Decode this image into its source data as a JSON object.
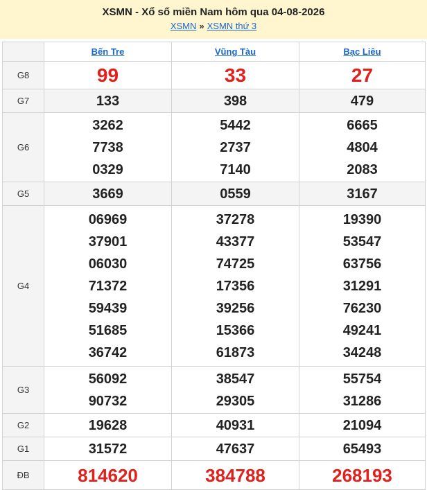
{
  "header": {
    "title": "XSMN - Xổ số miền Nam hôm qua 04-08-2026",
    "crumb_link1": "XSMN",
    "crumb_sep": "»",
    "crumb_link2": "XSMN thứ 3"
  },
  "columns": [
    "Bến Tre",
    "Vũng Tàu",
    "Bạc Liêu"
  ],
  "prizes": [
    {
      "label": "G8",
      "values": [
        [
          "99"
        ],
        [
          "33"
        ],
        [
          "27"
        ]
      ]
    },
    {
      "label": "G7",
      "values": [
        [
          "133"
        ],
        [
          "398"
        ],
        [
          "479"
        ]
      ]
    },
    {
      "label": "G6",
      "values": [
        [
          "3262",
          "7738",
          "0329"
        ],
        [
          "5442",
          "2737",
          "7140"
        ],
        [
          "6665",
          "4804",
          "2083"
        ]
      ]
    },
    {
      "label": "G5",
      "values": [
        [
          "3669"
        ],
        [
          "0559"
        ],
        [
          "3167"
        ]
      ]
    },
    {
      "label": "G4",
      "values": [
        [
          "06969",
          "37901",
          "06030",
          "71372",
          "59439",
          "51685",
          "36742"
        ],
        [
          "37278",
          "43377",
          "74725",
          "17356",
          "39256",
          "15366",
          "61873"
        ],
        [
          "19390",
          "53547",
          "63756",
          "31291",
          "76230",
          "49241",
          "34248"
        ]
      ]
    },
    {
      "label": "G3",
      "values": [
        [
          "56092",
          "90732"
        ],
        [
          "38547",
          "29305"
        ],
        [
          "55754",
          "31286"
        ]
      ]
    },
    {
      "label": "G2",
      "values": [
        [
          "19628"
        ],
        [
          "40931"
        ],
        [
          "21094"
        ]
      ]
    },
    {
      "label": "G1",
      "values": [
        [
          "31572"
        ],
        [
          "47637"
        ],
        [
          "65493"
        ]
      ]
    },
    {
      "label": "ĐB",
      "values": [
        [
          "814620"
        ],
        [
          "384788"
        ],
        [
          "268193"
        ]
      ]
    }
  ],
  "colors": {
    "header_bg": "#fff6cf",
    "highlight": "#e0211d",
    "link": "#1a66cc",
    "label_bg": "#f4f4f4"
  }
}
